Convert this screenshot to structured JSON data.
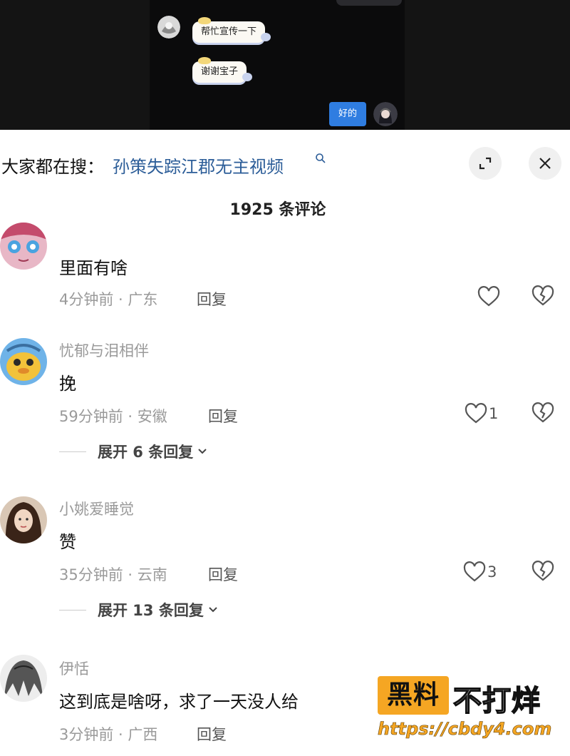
{
  "chat": {
    "messages": [
      {
        "text": "帮忙宣传一下"
      },
      {
        "text": "谢谢宝子"
      }
    ],
    "reply": "好的"
  },
  "search": {
    "prefix": "大家都在搜：",
    "term": "孙策失踪江郡无主视频",
    "icon": "search-icon"
  },
  "header": {
    "comment_count": "1925 条评论",
    "expand_icon": "expand-icon",
    "close_icon": "close-icon"
  },
  "comments": [
    {
      "name": "",
      "text": "里面有啥",
      "time_location": "4分钟前 · 广东",
      "reply_label": "回复",
      "likes": ""
    },
    {
      "name": "忧郁与泪相伴",
      "text": "挽",
      "time_location": "59分钟前 · 安徽",
      "reply_label": "回复",
      "likes": "1",
      "expand": "展开 6 条回复"
    },
    {
      "name": "小姚爱睡觉",
      "text": "赞",
      "time_location": "35分钟前 · 云南",
      "reply_label": "回复",
      "likes": "3",
      "expand": "展开 13 条回复"
    },
    {
      "name": "伊恬",
      "text": "这到底是啥呀，求了一天没人给",
      "time_location": "3分钟前 · 广西",
      "reply_label": "回复",
      "likes": ""
    }
  ],
  "watermark": {
    "box": "黑料",
    "text": "不打烊",
    "url": "https://cbdy4.com"
  },
  "colors": {
    "accent_blue": "#2f7de1",
    "search_term": "#2c5d98",
    "watermark_orange": "#f5a623"
  }
}
